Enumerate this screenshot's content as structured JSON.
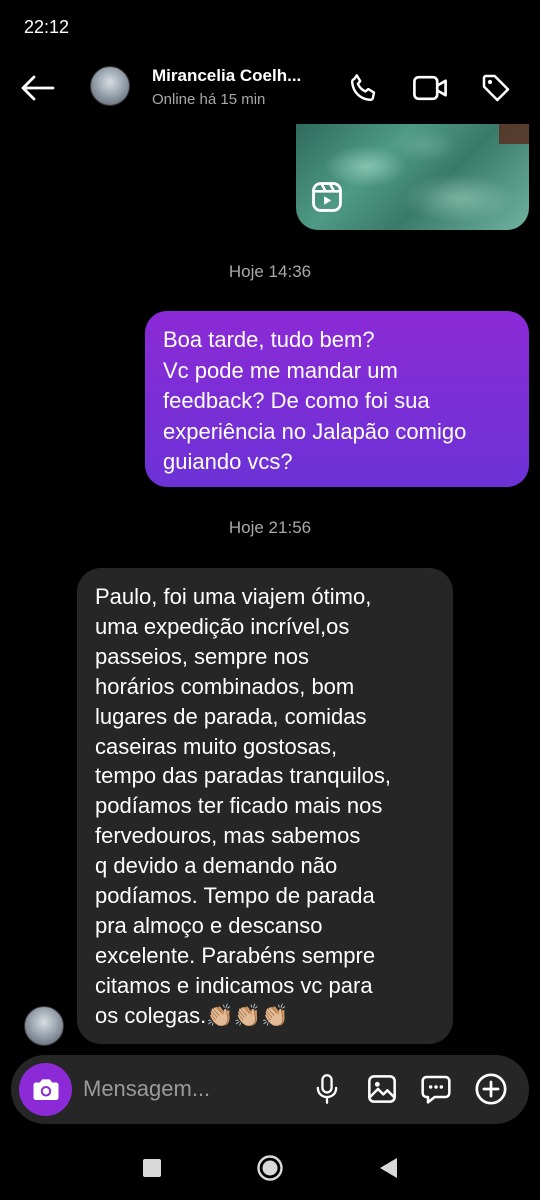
{
  "status_bar": {
    "time": "22:12"
  },
  "header": {
    "contact_name": "Mirancelia Coelh...",
    "presence": "Online há 15 min",
    "icons": {
      "back": "back-arrow-icon",
      "call": "phone-icon",
      "video": "video-camera-icon",
      "tag": "tag-icon"
    }
  },
  "messages": [
    {
      "type": "timestamp",
      "text": "Hoje 14:36"
    },
    {
      "type": "outgoing",
      "text": "Boa tarde, tudo bem?\nVc pode me mandar um\nfeedback? De como foi sua\nexperiência no Jalapão comigo\nguiando vcs?"
    },
    {
      "type": "timestamp",
      "text": "Hoje 21:56"
    },
    {
      "type": "incoming",
      "text": "Paulo, foi uma viajem ótimo,\numa expedição incrível,os\npasseios, sempre nos\nhorários combinados, bom\nlugares de parada, comidas\ncaseiras muito gostosas,\ntempo das paradas tranquilos,\npodíamos ter ficado mais nos\nfervedouros, mas sabemos\nq devido a demando não\npodíamos. Tempo de parada\npra almoço e descanso\nexcelente. Parabéns sempre\ncitamos e indicamos  vc para\nos colegas.👏🏼👏🏼👏🏼"
    }
  ],
  "composer": {
    "placeholder": "Mensagem...",
    "icons": {
      "camera": "camera-icon",
      "mic": "microphone-icon",
      "gallery": "gallery-icon",
      "sticker": "sticker-icon",
      "plus": "plus-icon"
    }
  },
  "navigation": {
    "icons": {
      "recent": "recent-apps-icon",
      "home": "home-icon",
      "back": "back-icon"
    }
  },
  "colors": {
    "accent": "#8b2ad6",
    "outgoing_bubble_end": "#6c32d6",
    "incoming_bubble": "#262626",
    "background": "#000000"
  }
}
